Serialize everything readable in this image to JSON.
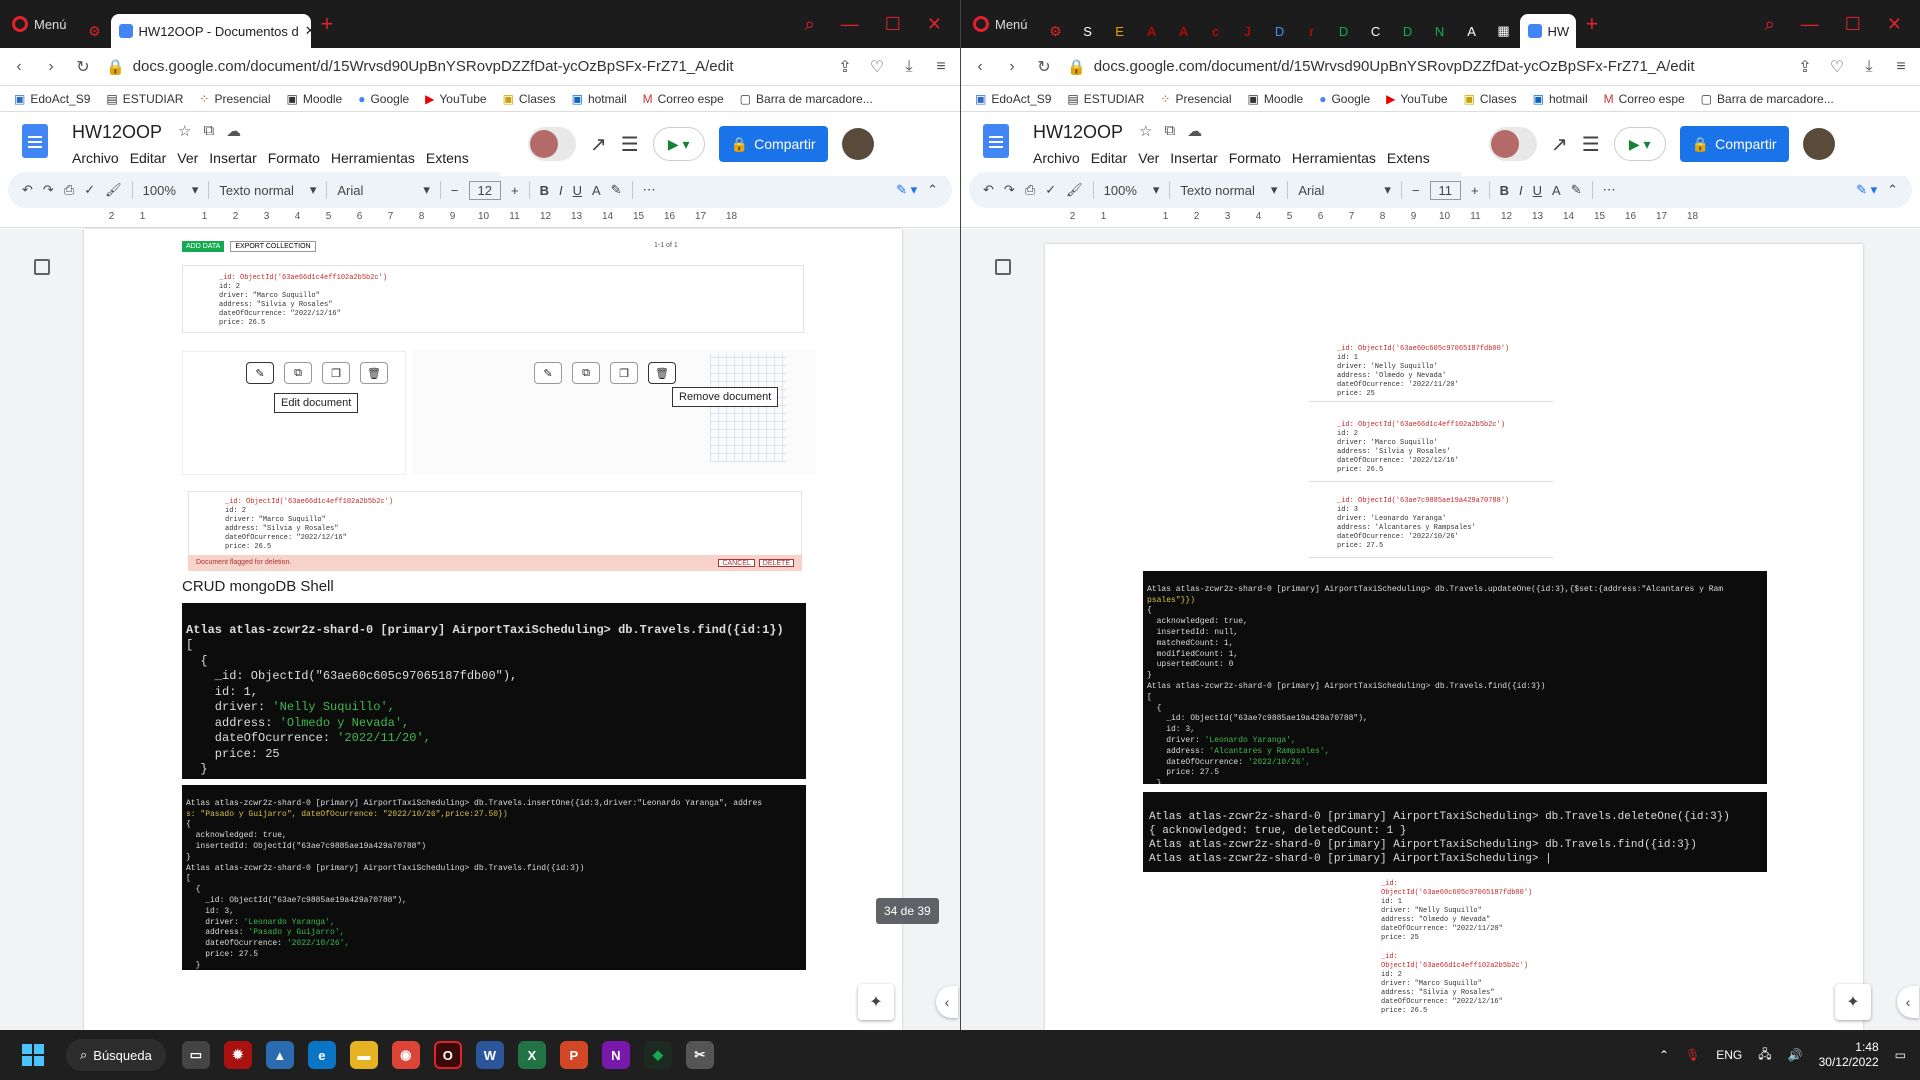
{
  "browser": {
    "menu_label": "Menú",
    "left_active_tab": "HW12OOP - Documentos d",
    "right_active_tab": "HW",
    "right_mini_tabs": [
      "S",
      "E",
      "A",
      "A",
      "c",
      "J",
      "D",
      "r",
      "D",
      "C",
      "D",
      "N",
      "A"
    ],
    "url": "docs.google.com/document/d/15Wrvsd90UpBnYSRovpDZZfDat-ycOzBpSFx-FrZ71_A/edit",
    "bookmarks": [
      "EdoAct_S9",
      "ESTUDIAR",
      "Presencial",
      "Moodle",
      "Google",
      "YouTube",
      "Clases",
      "hotmail",
      "Correo espe",
      "Barra de marcadore..."
    ]
  },
  "docs": {
    "title": "HW12OOP",
    "menus": [
      "Archivo",
      "Editar",
      "Ver",
      "Insertar",
      "Formato",
      "Herramientas",
      "Extens"
    ],
    "share_label": "Compartir",
    "zoom": "100%",
    "style": "Texto normal",
    "font": "Arial",
    "left_font_size": "12",
    "right_font_size": "11",
    "ruler": [
      "2",
      "1",
      "1",
      "2",
      "3",
      "4",
      "5",
      "6",
      "7",
      "8",
      "9",
      "10",
      "11",
      "12",
      "13",
      "14",
      "15",
      "16",
      "17",
      "18",
      "19"
    ]
  },
  "left": {
    "compass_top": {
      "add_data": "ADD DATA",
      "export": "EXPORT COLLECTION",
      "pager": "1-1 of 1",
      "id_line": "_id: ObjectId('63ae66d1c4eff102a2b5b2c')",
      "id": "id: 2",
      "driver": "driver: \"Marco Suquillo\"",
      "address": "address: \"Silvia y Rosales\"",
      "date": "dateOfOcurrence: \"2022/12/16\"",
      "price": "price: 26.5"
    },
    "tooltip_edit": "Edit document",
    "tooltip_remove": "Remove document",
    "compass_bottom": {
      "id_line": "_id: ObjectId('63ae66d1c4eff102a2b5b2c')",
      "id": "id: 2",
      "driver": "driver: \"Marco Suquillo\"",
      "address": "address: \"Silvia y Rosales\"",
      "date": "dateOfOcurrence: \"2022/12/16\"",
      "price": "price: 26.5",
      "flag": "Document flagged for deletion.",
      "cancel": "CANCEL",
      "delete": "DELETE"
    },
    "heading": "CRUD mongoDB Shell",
    "term1": {
      "prompt": "Atlas atlas-zcwr2z-shard-0 [primary] AirportTaxiScheduling> db.Travels.find({id:1})",
      "l1": "[",
      "l2": "  {",
      "l3": "    _id: ObjectId(\"63ae60c605c97065187fdb00\"),",
      "l4": "    id: 1,",
      "l5k": "    driver: ",
      "l5v": "'Nelly Suquillo',",
      "l6k": "    address: ",
      "l6v": "'Olmedo y Nevada',",
      "l7k": "    dateOfOcurrence: ",
      "l7v": "'2022/11/20',",
      "l8": "    price: 25",
      "l9": "  }",
      "l10": "]"
    },
    "term2": {
      "prompt": "Atlas atlas-zcwr2z-shard-0 [primary] AirportTaxiScheduling> db.Travels.insertOne({id:3,driver:\"Leonardo Yaranga\", addres",
      "prompt2": "s: \"Pasado y Guijarro\", dateOfOcurrence: \"2022/10/26\",price:27.50})",
      "a1": "{",
      "a2": "  acknowledged: true,",
      "a3": "  insertedId: ObjectId(\"63ae7c9885ae19a429a70788\")",
      "a4": "}",
      "find": "Atlas atlas-zcwr2z-shard-0 [primary] AirportTaxiScheduling> db.Travels.find({id:3})",
      "b1": "[",
      "b2": "  {",
      "b3": "    _id: ObjectId(\"63ae7c9885ae19a429a70788\"),",
      "b4": "    id: 3,",
      "b5k": "    driver: ",
      "b5v": "'Leonardo Yaranga',",
      "b6k": "    address: ",
      "b6v": "'Pasado y Guijarro',",
      "b7k": "    dateOfOcurrence: ",
      "b7v": "'2022/10/26',",
      "b8": "    price: 27.5",
      "b9": "  }",
      "b10": "]"
    },
    "page_badge": "34 de 39"
  },
  "right": {
    "snip1": {
      "id_line": "_id: ObjectId('63ae60c605c97065187fdb00')",
      "id": "id: 1",
      "driver": "driver: 'Nelly Suquillo'",
      "address": "address: 'Olmedo y Nevada'",
      "date": "dateOfOcurrence: '2022/11/20'",
      "price": "price: 25"
    },
    "snip2": {
      "id_line": "_id: ObjectId('63ae66d1c4eff102a2b5b2c')",
      "id": "id: 2",
      "driver": "driver: 'Marco Suquillo'",
      "address": "address: 'Silvia y Rosales'",
      "date": "dateOfOcurrence: '2022/12/16'",
      "price": "price: 26.5"
    },
    "snip3": {
      "id_line": "_id: ObjectId('63ae7c9885ae19a429a70788')",
      "id": "id: 3",
      "driver": "driver: 'Leonardo Yaranga'",
      "address": "address: 'Alcantares y Rampsales'",
      "date": "dateOfOcurrence: '2022/10/26'",
      "price": "price: 27.5"
    },
    "term3": {
      "p1": "Atlas atlas-zcwr2z-shard-0 [primary] AirportTaxiScheduling> db.Travels.updateOne({id:3},{$set:{address:\"Alcantares y Ram",
      "p2": "psales\"}})",
      "c1": "{",
      "c2": "  acknowledged: true,",
      "c3": "  insertedId: null,",
      "c4": "  matchedCount: 1,",
      "c5": "  modifiedCount: 1,",
      "c6": "  upsertedCount: 0",
      "c7": "}",
      "find": "Atlas atlas-zcwr2z-shard-0 [primary] AirportTaxiScheduling> db.Travels.find({id:3})",
      "d1": "[",
      "d2": "  {",
      "d3": "    _id: ObjectId(\"63ae7c9885ae19a429a70788\"),",
      "d4": "    id: 3,",
      "d5k": "    driver: ",
      "d5v": "'Leonardo Yaranga',",
      "d6k": "    address: ",
      "d6v": "'Alcantares y Rampsales',",
      "d7k": "    dateOfOcurrence: ",
      "d7v": "'2022/10/26',",
      "d8": "    price: 27.5",
      "d9": "  }",
      "d10": "]"
    },
    "term4": {
      "l1": "Atlas atlas-zcwr2z-shard-0 [primary] AirportTaxiScheduling> db.Travels.deleteOne({id:3})",
      "l2": "{ acknowledged: true, deletedCount: 1 }",
      "l3": "Atlas atlas-zcwr2z-shard-0 [primary] AirportTaxiScheduling> db.Travels.find({id:3})",
      "l4": "",
      "l5": "Atlas atlas-zcwr2z-shard-0 [primary] AirportTaxiScheduling> |"
    },
    "snip4": {
      "id_line": "_id: ObjectId('63ae60c605c97065187fdb00')",
      "id": "id: 1",
      "driver": "driver: \"Nelly Suquillo\"",
      "address": "address: \"Olmedo y Nevada\"",
      "date": "dateOfOcurrence: \"2022/11/20\"",
      "price": "price: 25"
    },
    "snip5": {
      "id_line": "_id: ObjectId('63ae66d1c4eff102a2b5b2c')",
      "id": "id: 2",
      "driver": "driver: \"Marco Suquillo\"",
      "address": "address: \"Silvia y Rosales\"",
      "date": "dateOfOcurrence: \"2022/12/16\"",
      "price": "price: 26.5"
    }
  },
  "taskbar": {
    "search": "Búsqueda",
    "lang": "ENG",
    "time": "1:48",
    "date": "30/12/2022"
  },
  "colors": {
    "accent": "#1a73e8",
    "opera": "#e0222b",
    "terminal_bg": "#0c0c0c",
    "string_green": "#3fb950"
  }
}
